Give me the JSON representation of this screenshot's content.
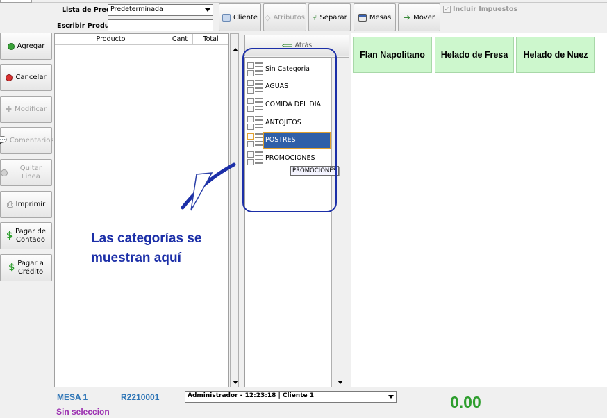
{
  "filters": {
    "price_list_label": "Lista de Precios",
    "price_list_value": "Predeterminada",
    "product_label": "Escribir Producto",
    "product_value": ""
  },
  "toolbar": {
    "cliente": "Cliente",
    "atributos": "Atributos",
    "separar": "Separar",
    "mesas": "Mesas",
    "mover": "Mover",
    "incluir_impuestos": "Incluir Impuestos"
  },
  "sidebar": {
    "agregar": "Agregar",
    "cancelar": "Cancelar",
    "modificar": "Modificar",
    "comentarios": "Comentarios",
    "quitar_linea": "Quitar Linea",
    "imprimir": "Imprimir",
    "pagar_contado_1": "Pagar de",
    "pagar_contado_2": "Contado",
    "pagar_credito_1": "Pagar a",
    "pagar_credito_2": "Crédito"
  },
  "grid": {
    "columns": [
      "Producto",
      "Cant",
      "Total"
    ]
  },
  "categories": {
    "back_label": "Atrás",
    "items": [
      "Sin Categoria",
      "AGUAS",
      "COMIDA DEL DIA",
      "ANTOJITOS",
      "POSTRES",
      "PROMOCIONES"
    ],
    "selected": "POSTRES",
    "tooltip": "PROMOCIONES"
  },
  "products": [
    "Flan Napolitano",
    "Helado de Fresa",
    "Helado de Nuez"
  ],
  "annotation": {
    "line1": "Las categorías se",
    "line2": "muestran aquí"
  },
  "status": {
    "table": "MESA 1",
    "ticket": "R2210001",
    "selection": "Sin seleccion",
    "user_session": "Administrador - 12:23:18 | Cliente 1",
    "total": "0.00"
  },
  "colors": {
    "accent_blue": "#1c2fa8",
    "product_green": "#cdf7cd",
    "selected_category": "#2f5fa8",
    "total_green": "#2e9e2e"
  }
}
